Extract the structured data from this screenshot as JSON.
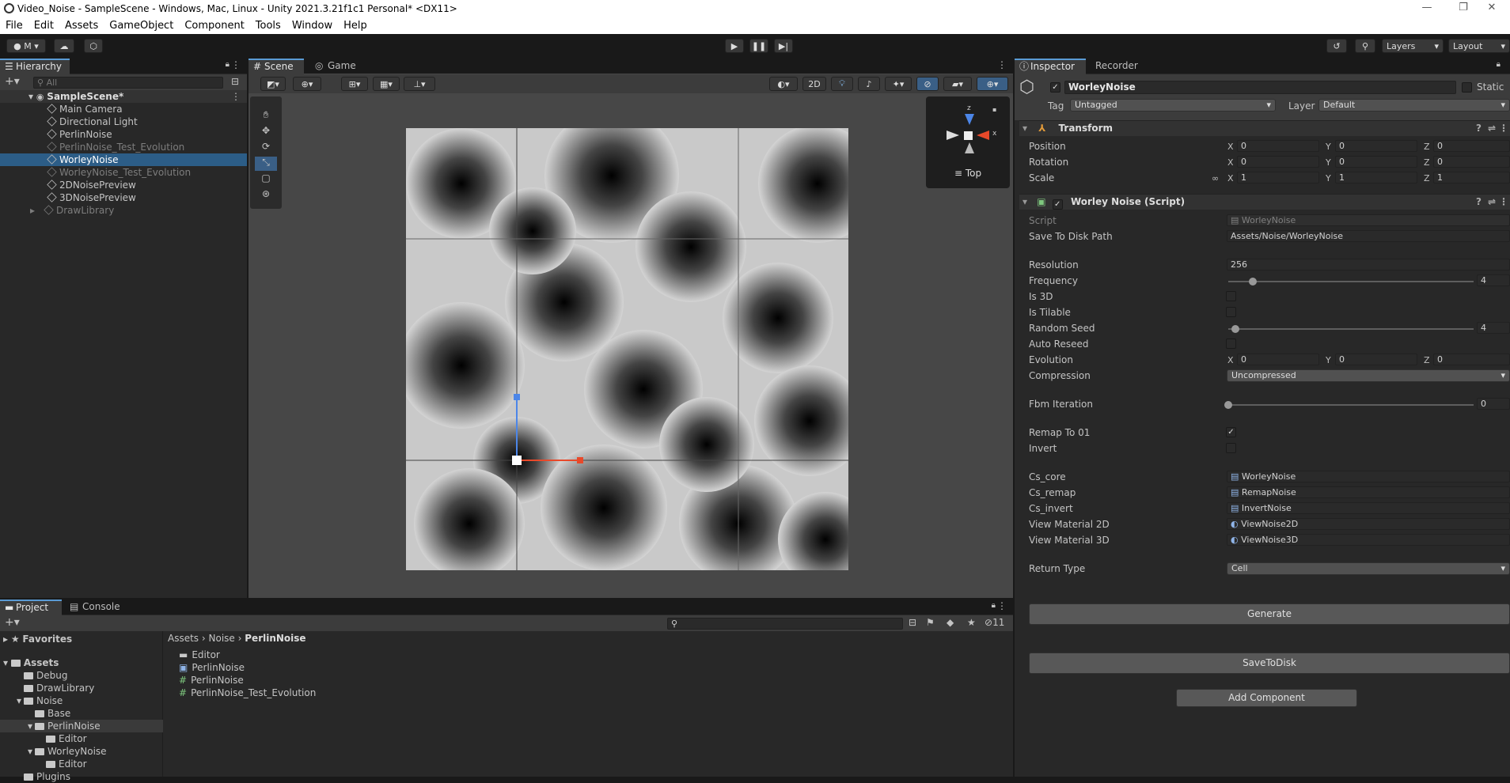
{
  "window": {
    "title": "Video_Noise - SampleScene - Windows, Mac, Linux - Unity 2021.3.21f1c1 Personal* <DX11>"
  },
  "menu": [
    "File",
    "Edit",
    "Assets",
    "GameObject",
    "Component",
    "Tools",
    "Window",
    "Help"
  ],
  "toolbar": {
    "account_label": "M",
    "layers_label": "Layers",
    "layout_label": "Layout"
  },
  "hierarchy": {
    "tab_label": "Hierarchy",
    "search_placeholder": "All",
    "scene_name": "SampleScene*",
    "items": [
      {
        "label": "Main Camera",
        "dim": false,
        "selected": false
      },
      {
        "label": "Directional Light",
        "dim": false,
        "selected": false
      },
      {
        "label": "PerlinNoise",
        "dim": false,
        "selected": false
      },
      {
        "label": "PerlinNoise_Test_Evolution",
        "dim": true,
        "selected": false
      },
      {
        "label": "WorleyNoise",
        "dim": false,
        "selected": true
      },
      {
        "label": "WorleyNoise_Test_Evolution",
        "dim": true,
        "selected": false
      },
      {
        "label": "2DNoisePreview",
        "dim": false,
        "selected": false
      },
      {
        "label": "3DNoisePreview",
        "dim": false,
        "selected": false
      },
      {
        "label": "DrawLibrary",
        "dim": true,
        "selected": false
      }
    ]
  },
  "scene": {
    "tab_scene": "Scene",
    "tab_game": "Game",
    "mode_2d": "2D",
    "gizmo_view_label": "Top",
    "gizmo_axes": {
      "y": "z",
      "x": "x"
    }
  },
  "project": {
    "tab_project": "Project",
    "tab_console": "Console",
    "hidden_count": "11",
    "favorites_label": "Favorites",
    "assets_label": "Assets",
    "tree": [
      {
        "label": "Debug",
        "depth": 1
      },
      {
        "label": "DrawLibrary",
        "depth": 1
      },
      {
        "label": "Noise",
        "depth": 1
      },
      {
        "label": "Base",
        "depth": 2
      },
      {
        "label": "PerlinNoise",
        "depth": 2
      },
      {
        "label": "Editor",
        "depth": 3
      },
      {
        "label": "WorleyNoise",
        "depth": 2
      },
      {
        "label": "Editor",
        "depth": 3
      },
      {
        "label": "Plugins",
        "depth": 1
      }
    ],
    "breadcrumb": [
      "Assets",
      "Noise",
      "PerlinNoise"
    ],
    "files": [
      {
        "label": "Editor",
        "icon": "folder-icon"
      },
      {
        "label": "PerlinNoise",
        "icon": "compute-shader-icon"
      },
      {
        "label": "PerlinNoise",
        "icon": "script-icon"
      },
      {
        "label": "PerlinNoise_Test_Evolution",
        "icon": "script-icon"
      }
    ]
  },
  "inspector": {
    "tab_inspector": "Inspector",
    "tab_recorder": "Recorder",
    "object_name": "WorleyNoise",
    "static_label": "Static",
    "tag_label": "Tag",
    "tag_value": "Untagged",
    "layer_label": "Layer",
    "layer_value": "Default",
    "transform": {
      "header": "Transform",
      "rows": [
        {
          "label": "Position",
          "x": "0",
          "y": "0",
          "z": "0"
        },
        {
          "label": "Rotation",
          "x": "0",
          "y": "0",
          "z": "0"
        },
        {
          "label": "Scale",
          "x": "1",
          "y": "1",
          "z": "1"
        }
      ]
    },
    "script": {
      "header": "Worley Noise (Script)",
      "script_label": "Script",
      "script_value": "WorleyNoise",
      "save_path_label": "Save To Disk Path",
      "save_path_value": "Assets/Noise/WorleyNoise",
      "resolution_label": "Resolution",
      "resolution_value": "256",
      "frequency_label": "Frequency",
      "frequency_value": "4",
      "frequency_fraction": 0.1,
      "is3d_label": "Is 3D",
      "istilable_label": "Is Tilable",
      "seed_label": "Random Seed",
      "seed_value": "4",
      "seed_fraction": 0.03,
      "autoreseed_label": "Auto Reseed",
      "evolution_label": "Evolution",
      "evolution": {
        "x": "0",
        "y": "0",
        "z": "0"
      },
      "compression_label": "Compression",
      "compression_value": "Uncompressed",
      "fbm_label": "Fbm Iteration",
      "fbm_value": "0",
      "fbm_fraction": 0.0,
      "remap_label": "Remap To 01",
      "invert_label": "Invert",
      "cs_core_label": "Cs_core",
      "cs_core_value": "WorleyNoise",
      "cs_remap_label": "Cs_remap",
      "cs_remap_value": "RemapNoise",
      "cs_invert_label": "Cs_invert",
      "cs_invert_value": "InvertNoise",
      "view2d_label": "View Material 2D",
      "view2d_value": "ViewNoise2D",
      "view3d_label": "View Material 3D",
      "view3d_value": "ViewNoise3D",
      "return_label": "Return Type",
      "return_value": "Cell"
    },
    "generate_button": "Generate",
    "save_button": "SaveToDisk",
    "add_component_button": "Add Component"
  },
  "colors": {
    "accent": "#5a9bd5",
    "selection": "#2c5d87",
    "gizmo_x": "#e8492a",
    "gizmo_y": "#4c86e8"
  }
}
